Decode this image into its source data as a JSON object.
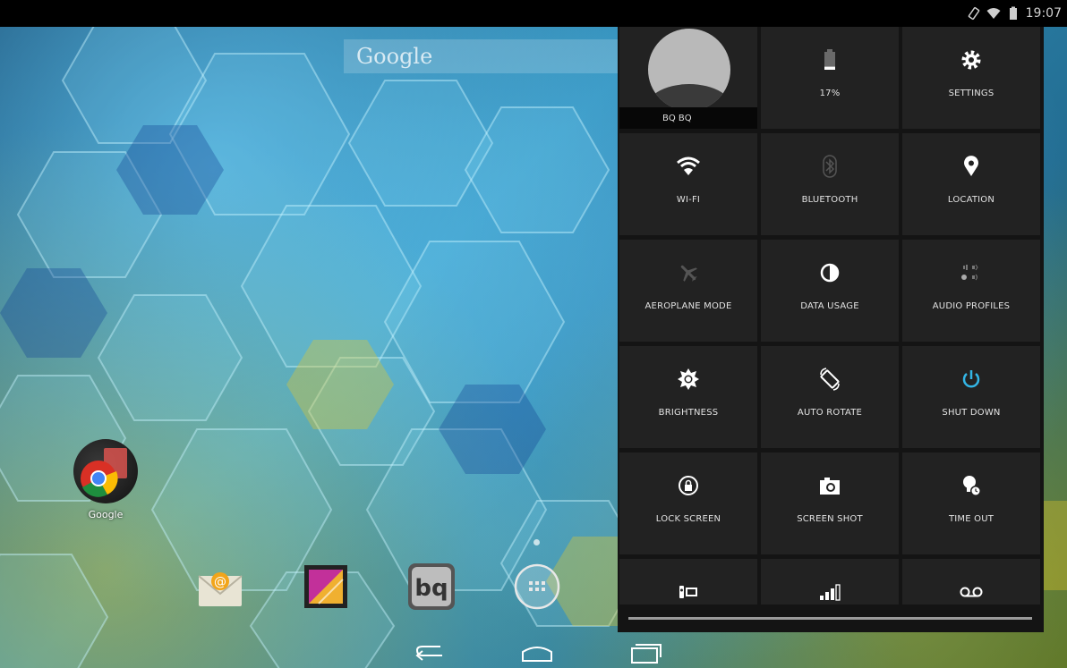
{
  "status_bar": {
    "time": "19:07",
    "icons": [
      "rotation-lock-icon",
      "wifi-icon",
      "battery-icon"
    ]
  },
  "search": {
    "label": "Google"
  },
  "desktop": {
    "folder": {
      "label": "Google",
      "icon": "chrome-icon"
    },
    "dock": [
      "email-icon",
      "gallery-icon",
      "bq-icon",
      "all-apps-icon"
    ]
  },
  "nav_bar": [
    "back-icon",
    "home-icon",
    "recents-icon"
  ],
  "quick_settings": {
    "user": {
      "name": "BQ BQ"
    },
    "battery": {
      "label": "17%",
      "level": 0.17
    },
    "tiles": {
      "settings": "SETTINGS",
      "wifi": "WI-FI",
      "bluetooth": "BLUETOOTH",
      "location": "LOCATION",
      "aeroplane": "AEROPLANE MODE",
      "data_usage": "DATA USAGE",
      "audio_profiles": "AUDIO PROFILES",
      "brightness": "BRIGHTNESS",
      "auto_rotate": "AUTO ROTATE",
      "shut_down": "SHUT DOWN",
      "lock_screen": "LOCK SCREEN",
      "screen_shot": "SCREEN SHOT",
      "time_out": "TIME OUT"
    },
    "colors": {
      "active_blue": "#33b5e5",
      "disabled": "#555555"
    }
  }
}
